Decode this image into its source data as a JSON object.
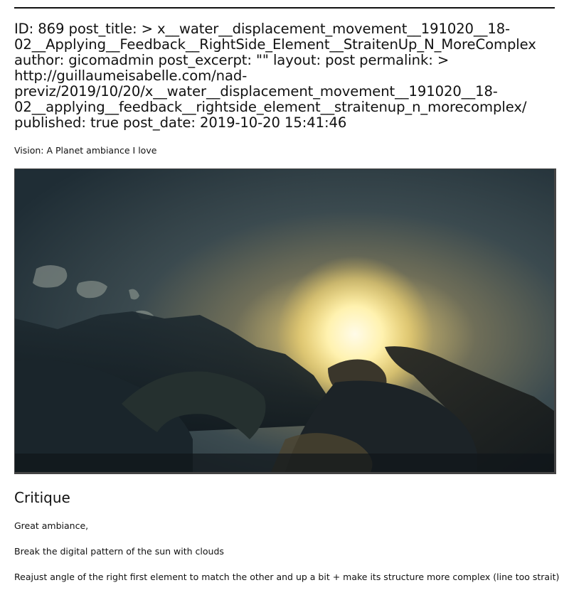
{
  "header": {
    "lines": [
      "ID: 869 post_title: > x__water__displacement_movement__191020__18-",
      "02__Applying__Feedback__RightSide_Element__StraitenUp_N_MoreComplex",
      "author: gicomadmin post_excerpt: \"\" layout: post permalink: >",
      "http://guillaumeisabelle.com/nad-",
      "previz/2019/10/20/x__water__displacement_movement__191020__18-",
      "02__applying__feedback__rightside_element__straitenup_n_morecomplex/",
      "published: true post_date: 2019-10-20 15:41:46"
    ]
  },
  "vision": "Vision: A Planet ambiance I love",
  "image": {
    "subject": "render-sun-over-rocks"
  },
  "critique": {
    "title": "Critique",
    "items": [
      "Great ambiance,",
      "Break the digital pattern of the sun with clouds",
      "Reajust angle of the right first element to match the other and up a bit + make its structure more complex (line too strait)"
    ]
  }
}
